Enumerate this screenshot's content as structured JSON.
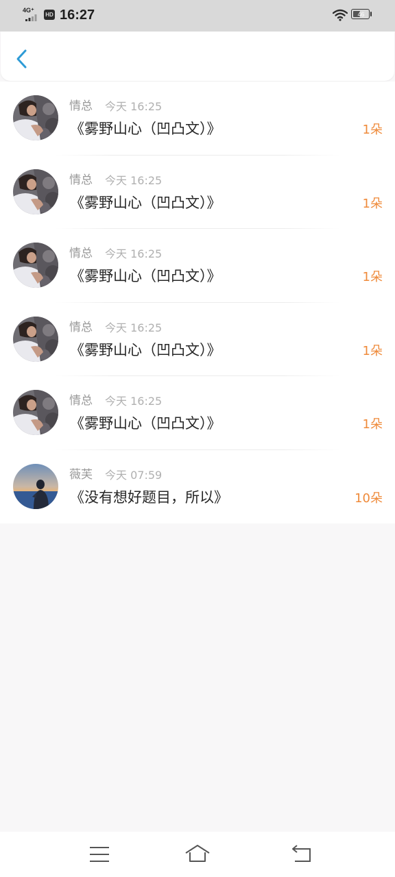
{
  "status_bar": {
    "network": "4G⁺",
    "hd_label": "HD",
    "time": "16:27",
    "battery_level": "46",
    "battery_fraction": 0.46
  },
  "header": {
    "back_icon": "chevron-left-icon",
    "accent_color": "#2e9bd6"
  },
  "list": {
    "items": [
      {
        "name": "情总",
        "time": "今天 16:25",
        "title": "《雾野山心（凹凸文）》",
        "count": "1朵",
        "avatar": "avatar-girl-rocks"
      },
      {
        "name": "情总",
        "time": "今天 16:25",
        "title": "《雾野山心（凹凸文）》",
        "count": "1朵",
        "avatar": "avatar-girl-rocks"
      },
      {
        "name": "情总",
        "time": "今天 16:25",
        "title": "《雾野山心（凹凸文）》",
        "count": "1朵",
        "avatar": "avatar-girl-rocks"
      },
      {
        "name": "情总",
        "time": "今天 16:25",
        "title": "《雾野山心（凹凸文）》",
        "count": "1朵",
        "avatar": "avatar-girl-rocks"
      },
      {
        "name": "情总",
        "time": "今天 16:25",
        "title": "《雾野山心（凹凸文）》",
        "count": "1朵",
        "avatar": "avatar-girl-rocks"
      },
      {
        "name": "薇芙",
        "time": "今天 07:59",
        "title": "《没有想好题目，所以》",
        "count": "10朵",
        "avatar": "avatar-sunset-silhouette"
      }
    ]
  },
  "colors": {
    "count": "#ef8a3a",
    "name": "#9a9a9a",
    "time": "#b0b0b0",
    "title": "#262626",
    "background": "#f8f7f8"
  },
  "nav_bar": {
    "menu_icon": "menu-icon",
    "home_icon": "home-icon",
    "back_icon": "back-arrow-icon"
  }
}
